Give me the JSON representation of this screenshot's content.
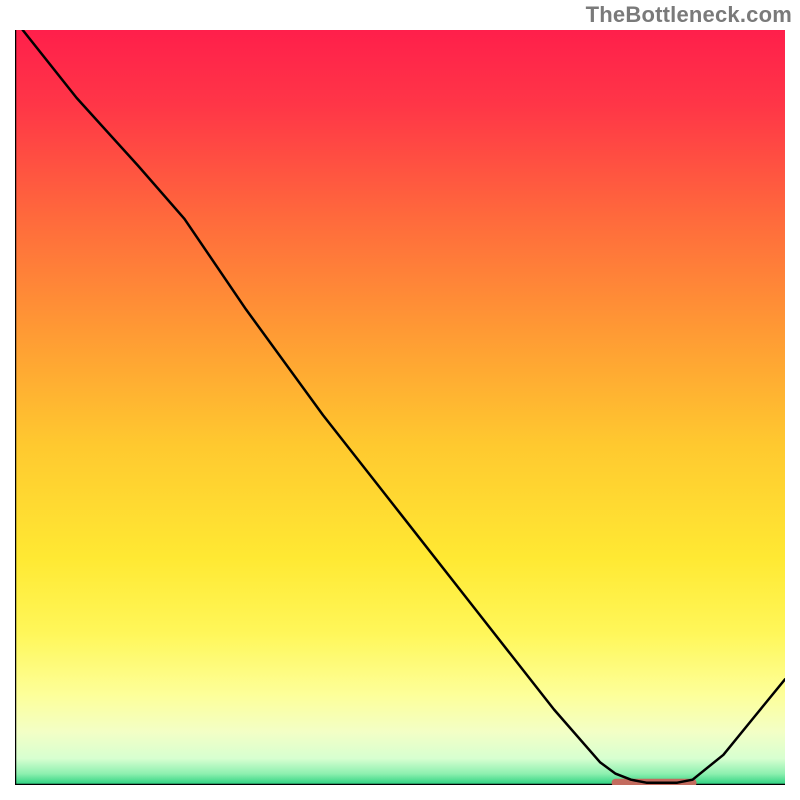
{
  "watermark": "TheBottleneck.com",
  "chart_data": {
    "type": "line",
    "title": "",
    "xlabel": "",
    "ylabel": "",
    "xlim": [
      0,
      100
    ],
    "ylim": [
      0,
      100
    ],
    "grid": false,
    "series": [
      {
        "name": "curve",
        "x": [
          1,
          8,
          16,
          22,
          30,
          40,
          50,
          60,
          70,
          76,
          78,
          80,
          82,
          84,
          86,
          88,
          92,
          96,
          100
        ],
        "y": [
          100,
          91,
          82,
          75,
          63,
          49,
          36,
          23,
          10,
          3,
          1.5,
          0.7,
          0.3,
          0.3,
          0.3,
          0.7,
          4,
          9,
          14
        ],
        "color": "#000000"
      }
    ],
    "highlight_segment": {
      "name": "valley-flat",
      "x_start": 78,
      "x_end": 88,
      "y": 0.3,
      "color": "#c36b5e"
    },
    "background_gradient": {
      "stops": [
        {
          "offset": 0.0,
          "color": "#ff1f4b"
        },
        {
          "offset": 0.1,
          "color": "#ff3647"
        },
        {
          "offset": 0.25,
          "color": "#ff6a3c"
        },
        {
          "offset": 0.4,
          "color": "#ff9a34"
        },
        {
          "offset": 0.55,
          "color": "#ffc92f"
        },
        {
          "offset": 0.7,
          "color": "#ffe933"
        },
        {
          "offset": 0.8,
          "color": "#fff75a"
        },
        {
          "offset": 0.88,
          "color": "#fdff99"
        },
        {
          "offset": 0.93,
          "color": "#f3ffc6"
        },
        {
          "offset": 0.965,
          "color": "#d7ffd0"
        },
        {
          "offset": 0.985,
          "color": "#8ef0b0"
        },
        {
          "offset": 1.0,
          "color": "#28d07e"
        }
      ]
    }
  }
}
